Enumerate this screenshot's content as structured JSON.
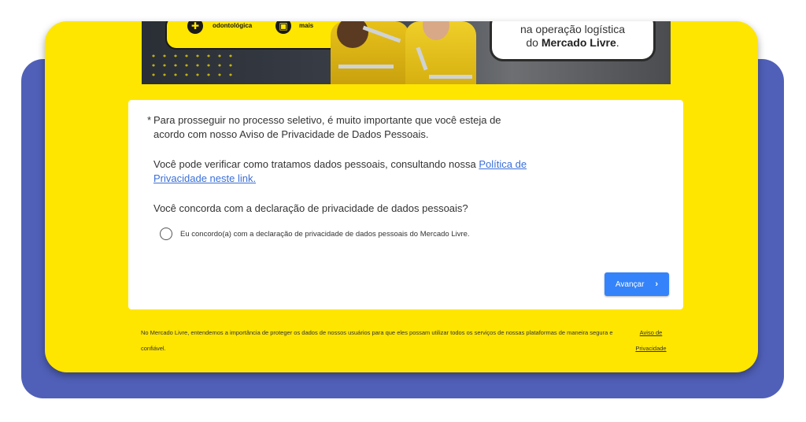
{
  "banner": {
    "badge_left_text": "médica e odontológica",
    "badge_right_text": "e muito mais",
    "speech_line1": "na operação logística",
    "speech_line2_prefix": "do",
    "speech_brand": "Mercado Livre",
    "speech_suffix": "."
  },
  "form": {
    "intro_asterisk": "*",
    "intro_text": "Para prosseguir no processo seletivo, é muito importante que você esteja de acordo com nosso Aviso de Privacidade de Dados Pessoais.",
    "policy_text": "Você pode verificar como tratamos dados pessoais, consultando nossa ",
    "policy_link": "Política de Privacidade neste link.",
    "question": "Você concorda com a declaração de privacidade de dados pessoais?",
    "radio_label": "Eu concordo(a) com a declaração de privacidade de dados pessoais do Mercado Livre.",
    "next_button": "Avançar",
    "next_icon": "chevron-right-icon"
  },
  "footer": {
    "text": "No Mercado Livre, entendemos a importância de proteger os dados de nossos usuários para que eles possam utilizar todos os serviços de nossas plataformas de maneira segura e confiável.",
    "link": "Aviso de Privacidade"
  },
  "colors": {
    "brand_yellow": "#ffe600",
    "back_panel": "#5060b8",
    "button_blue": "#3483fa",
    "link_blue": "#3a6fd8"
  }
}
